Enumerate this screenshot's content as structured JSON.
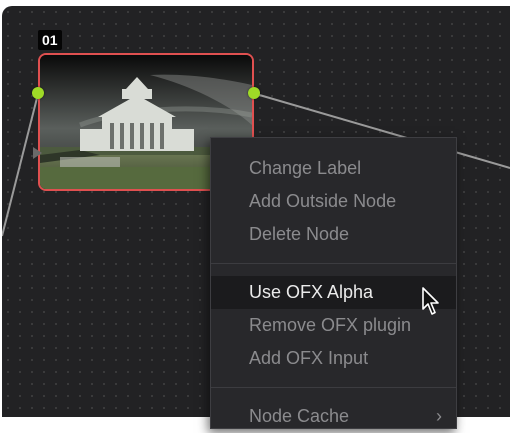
{
  "node": {
    "label": "01",
    "port_color": "#9fda27",
    "border_color": "#e05050"
  },
  "context_menu": {
    "group_1": [
      {
        "label": "Change Label"
      },
      {
        "label": "Add Outside Node"
      },
      {
        "label": "Delete Node"
      }
    ],
    "group_2": [
      {
        "label": "Use OFX Alpha",
        "hovered": true
      },
      {
        "label": "Remove OFX plugin"
      },
      {
        "label": "Add OFX Input"
      }
    ],
    "group_3": [
      {
        "label": "Node Cache",
        "submenu_icon": "chevron-right-icon"
      }
    ]
  },
  "cursor": {
    "icon": "arrow-pointer-icon"
  }
}
